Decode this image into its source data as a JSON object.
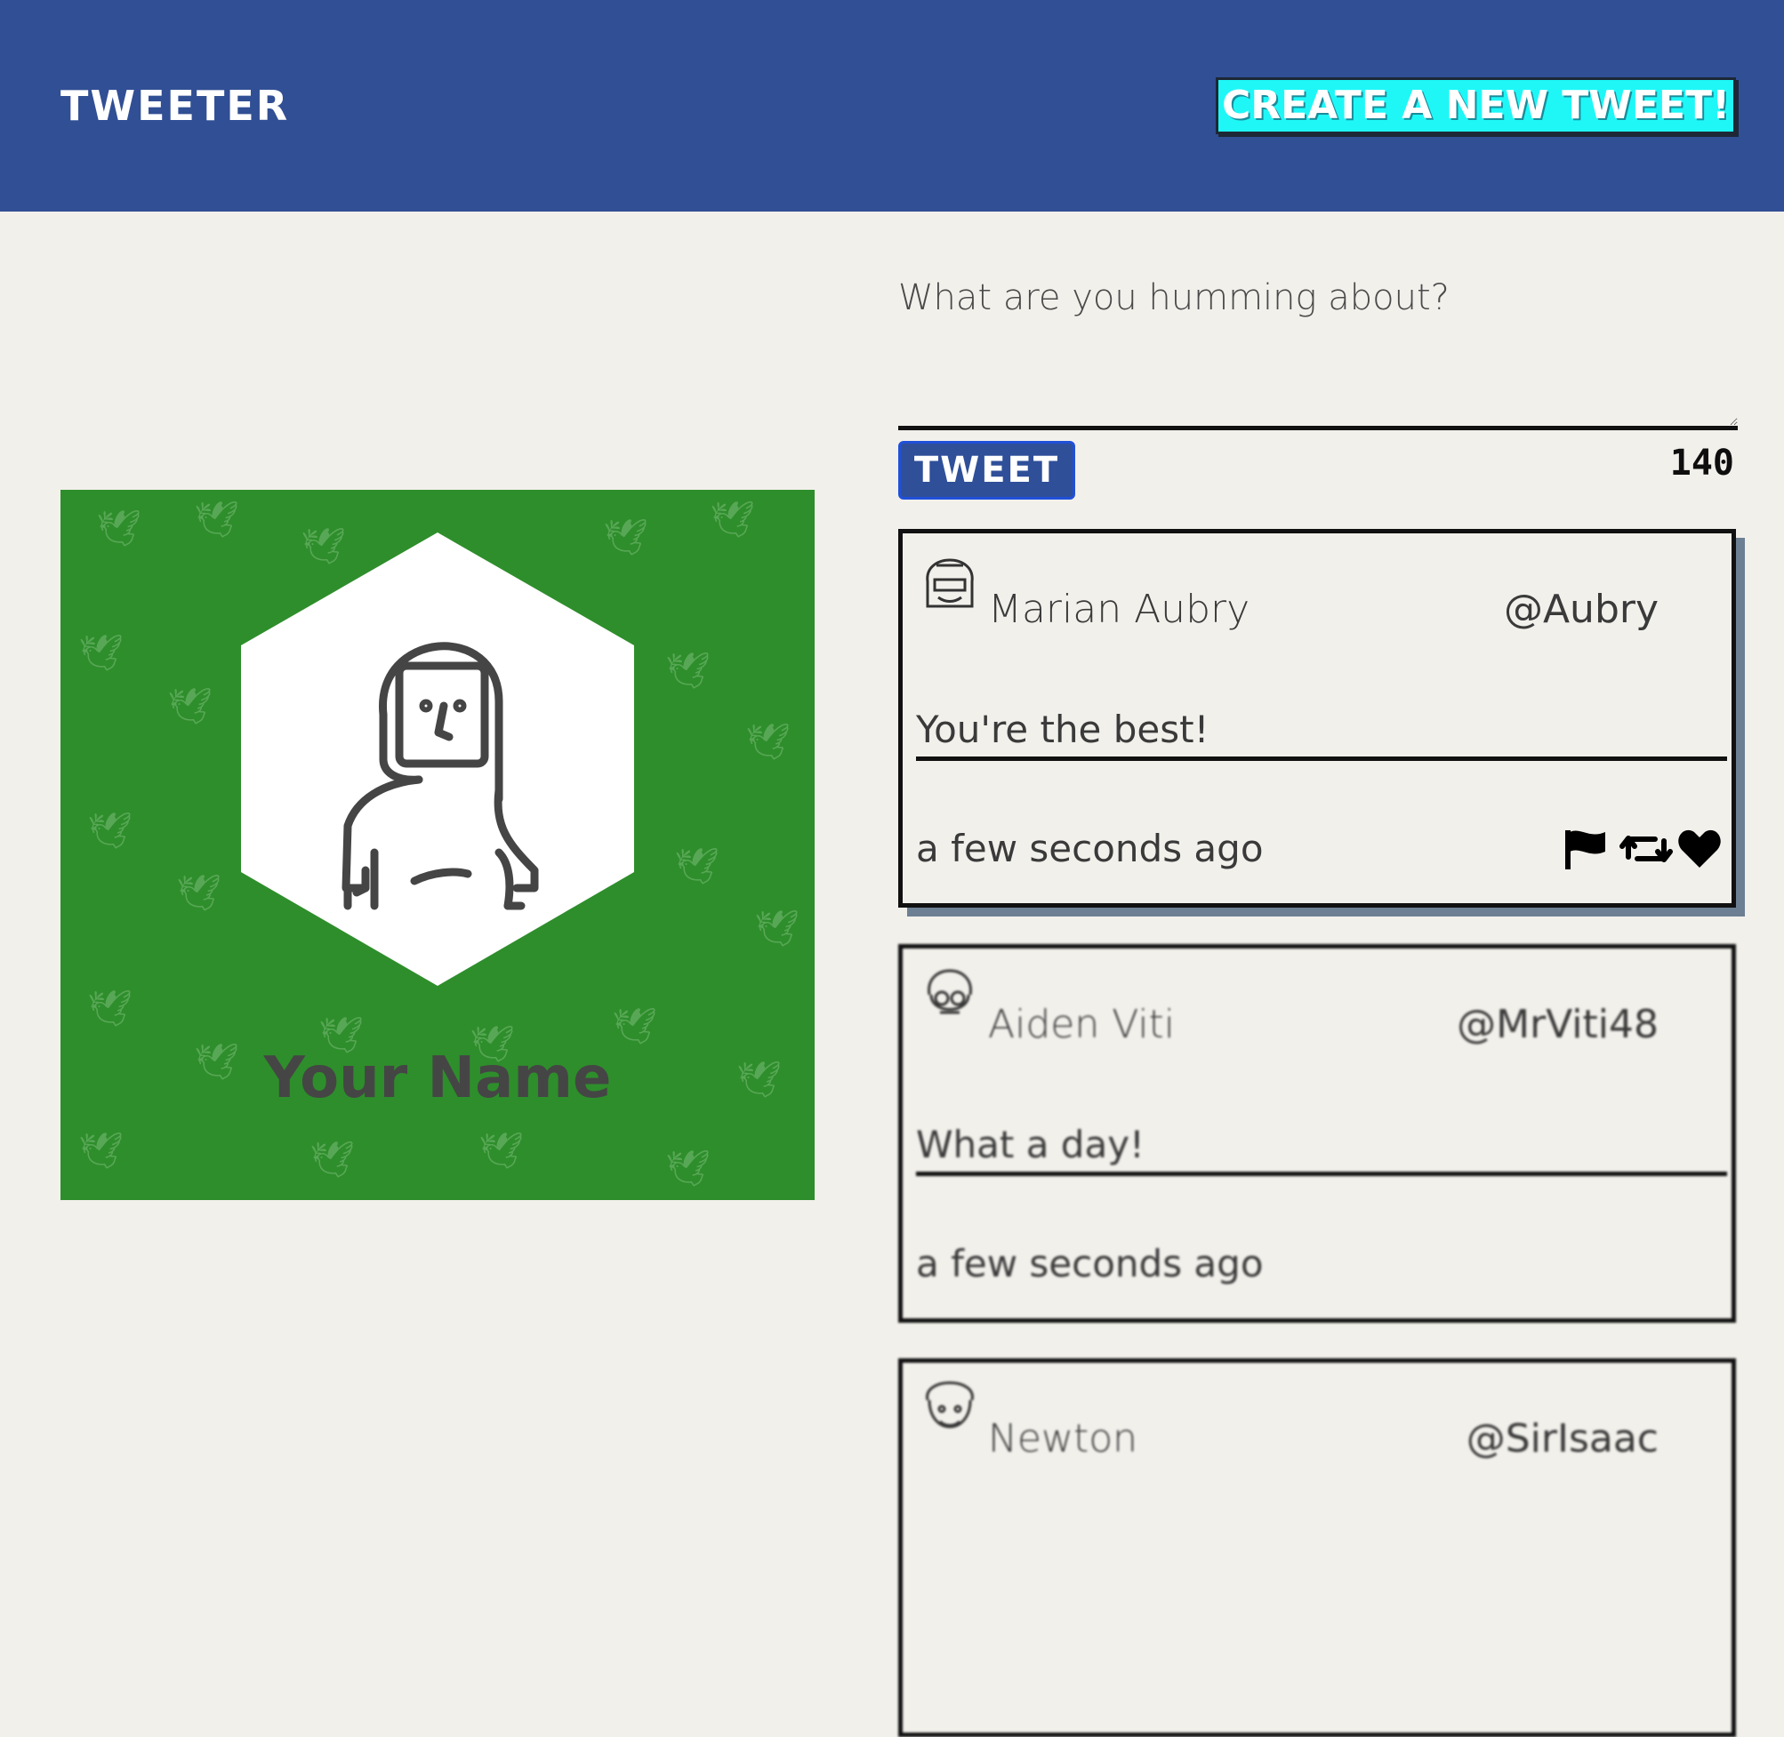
{
  "nav": {
    "brand": "Tweeter",
    "new_tweet_label": "Create a new tweet!"
  },
  "profile": {
    "name": "Your Name",
    "background_color": "#2e8e2b"
  },
  "composer": {
    "placeholder": "What are you humming about?",
    "value": "",
    "button_label": "Tweet",
    "char_count": "140"
  },
  "tweets": [
    {
      "name": "Marian Aubry",
      "handle": "@Aubry",
      "text": "You're the best!",
      "time": "a few seconds ago"
    },
    {
      "name": "Aiden Viti",
      "handle": "@MrViti48",
      "text": "What a day!",
      "time": "a few seconds ago"
    },
    {
      "name": "Newton",
      "handle": "@SirIsaac",
      "text": "",
      "time": ""
    }
  ],
  "icons": {
    "flag": "flag-icon",
    "retweet": "retweet-icon",
    "like": "heart-icon"
  },
  "colors": {
    "nav": "#314f94",
    "accent": "#1ff7f7",
    "page": "#f2f0eb",
    "button": "#2f4f99"
  }
}
